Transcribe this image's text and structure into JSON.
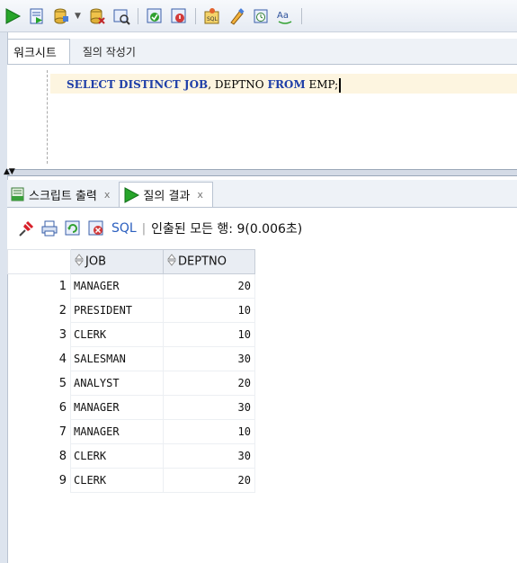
{
  "toolbar": {
    "icons": [
      "run-statement-icon",
      "run-script-icon",
      "commit-icon",
      "rollback-icon",
      "autotrace-icon",
      "explain-plan-icon",
      "sql-tuning-icon",
      "clear-icon",
      "history-icon",
      "case-icon"
    ]
  },
  "worksheet_tabs": [
    {
      "label": "워크시트",
      "active": true
    },
    {
      "label": "질의 작성기",
      "active": false
    }
  ],
  "editor": {
    "sql_parts": {
      "select": "SELECT DISTINCT",
      "job": " JOB",
      "mid": ", DEPTNO ",
      "from": "FROM",
      "end": " EMP;"
    }
  },
  "output_tabs": [
    {
      "label": "스크립트 출력",
      "close": "x",
      "icon": "script-output-icon"
    },
    {
      "label": "질의 결과",
      "close": "x",
      "icon": "query-result-icon",
      "active": true
    }
  ],
  "result_toolbar": {
    "sql_label": "SQL",
    "separator": "|",
    "status": "인출된 모든 행: 9(0.006초)"
  },
  "grid": {
    "columns": [
      "JOB",
      "DEPTNO"
    ],
    "rows": [
      {
        "n": "1",
        "job": "MANAGER",
        "deptno": "20"
      },
      {
        "n": "2",
        "job": "PRESIDENT",
        "deptno": "10"
      },
      {
        "n": "3",
        "job": "CLERK",
        "deptno": "10"
      },
      {
        "n": "4",
        "job": "SALESMAN",
        "deptno": "30"
      },
      {
        "n": "5",
        "job": "ANALYST",
        "deptno": "20"
      },
      {
        "n": "6",
        "job": "MANAGER",
        "deptno": "30"
      },
      {
        "n": "7",
        "job": "MANAGER",
        "deptno": "10"
      },
      {
        "n": "8",
        "job": "CLERK",
        "deptno": "30"
      },
      {
        "n": "9",
        "job": "CLERK",
        "deptno": "20"
      }
    ]
  },
  "colors": {
    "keyword": "#1f3fa8",
    "accent_green": "#2fa02f",
    "sql_link": "#2b5fbf"
  }
}
